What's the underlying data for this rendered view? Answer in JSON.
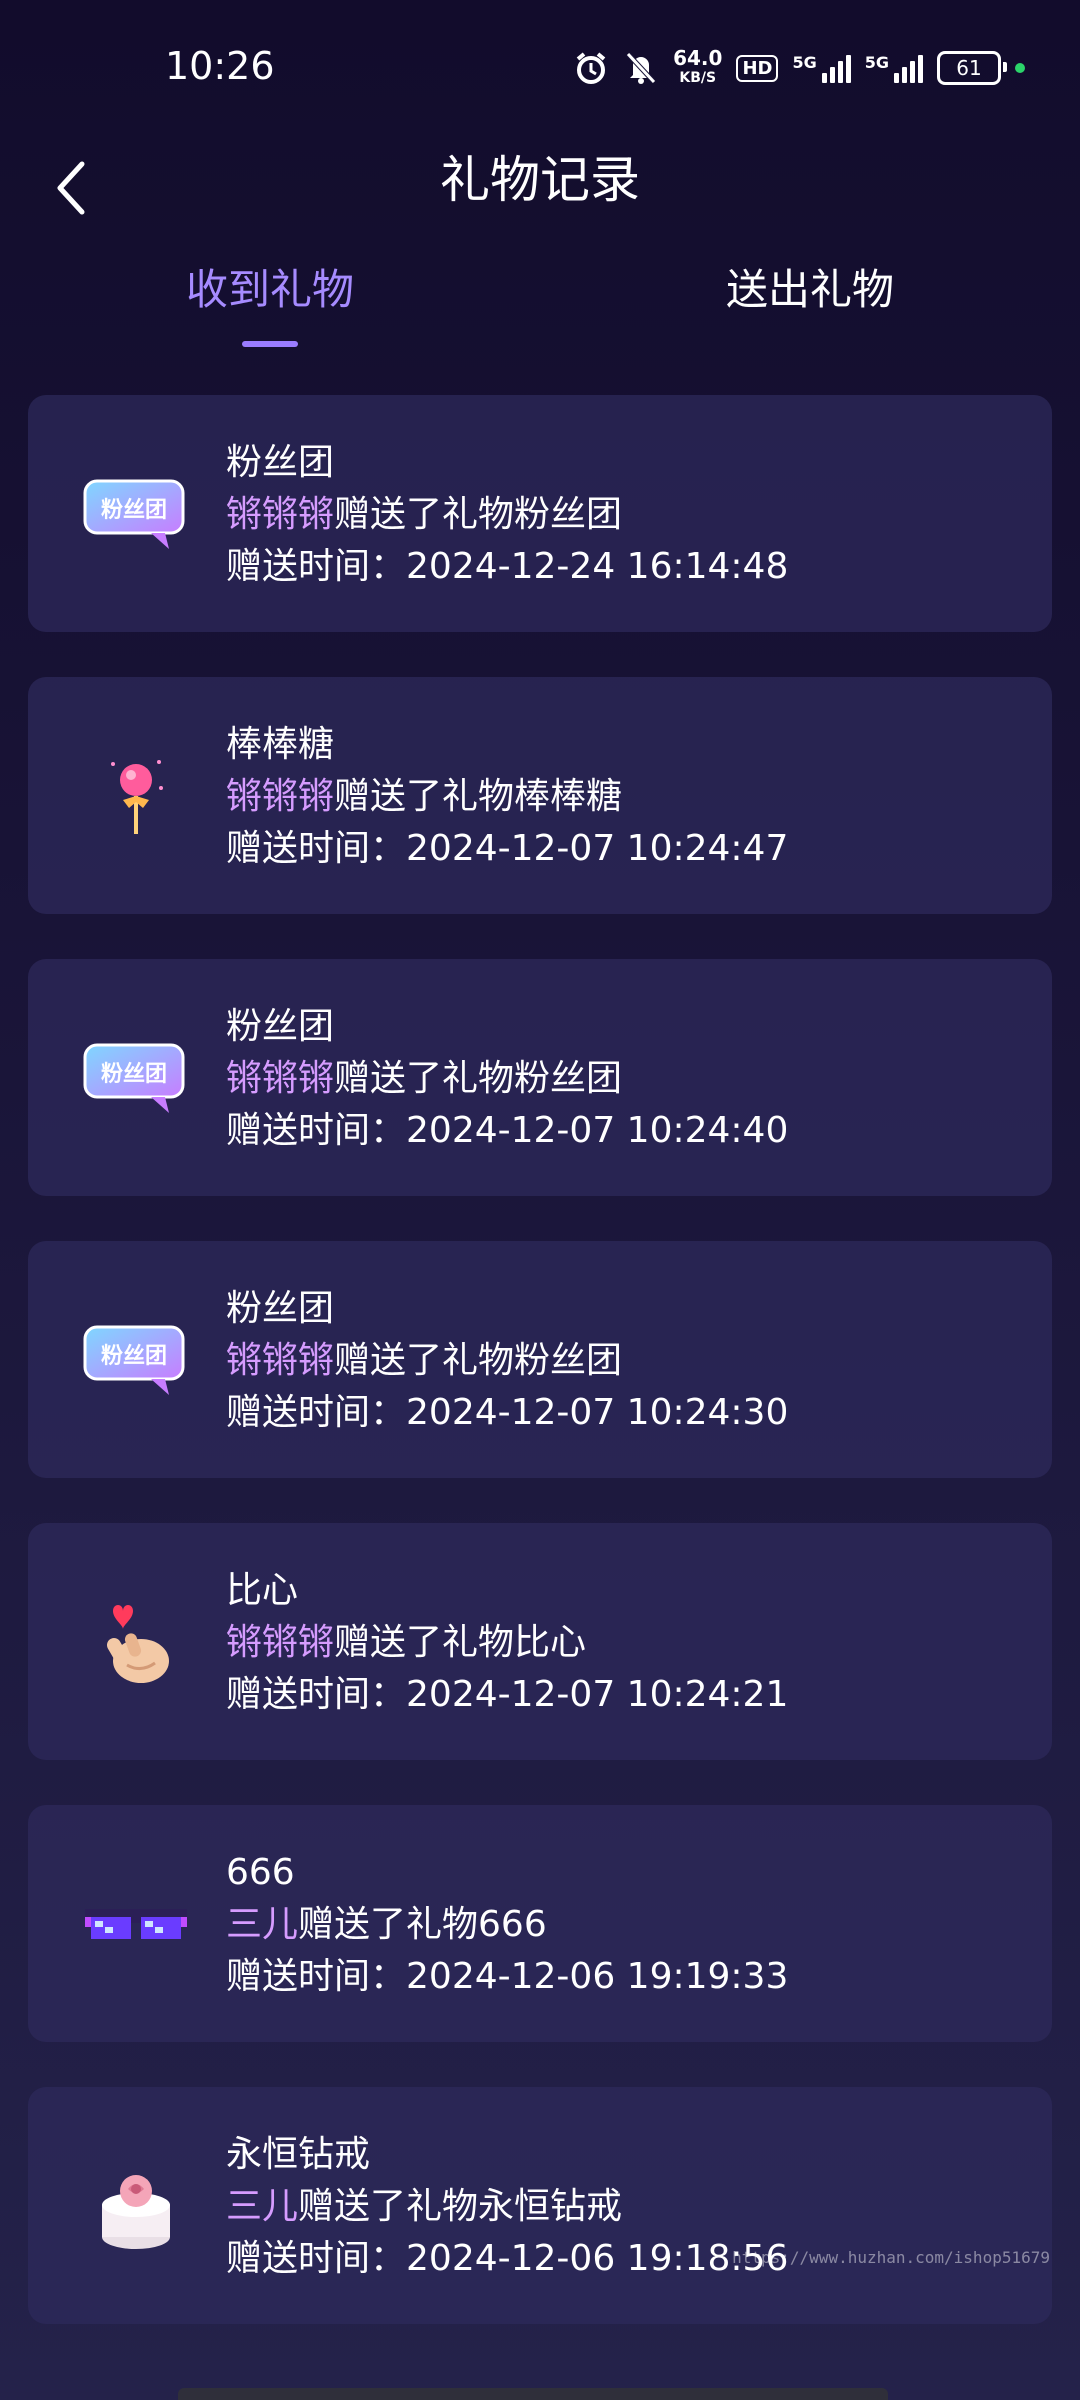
{
  "status_bar": {
    "time": "10:26",
    "net_speed_value": "64.0",
    "net_speed_unit": "KB/S",
    "hd_label": "HD",
    "signal1_label": "5G",
    "signal2_label": "5G",
    "battery": "61"
  },
  "header": {
    "title": "礼物记录"
  },
  "tabs": [
    {
      "label": "收到礼物",
      "active": true
    },
    {
      "label": "送出礼物",
      "active": false
    }
  ],
  "records": [
    {
      "gift_name": "粉丝团",
      "sender": "锵锵锵",
      "action_text": "赠送了礼物粉丝团",
      "time_label": "赠送时间：",
      "time": "2024-12-24 16:14:48",
      "icon": "fan-club-badge-icon"
    },
    {
      "gift_name": "棒棒糖",
      "sender": "锵锵锵",
      "action_text": "赠送了礼物棒棒糖",
      "time_label": "赠送时间：",
      "time": "2024-12-07 10:24:47",
      "icon": "lollipop-icon"
    },
    {
      "gift_name": "粉丝团",
      "sender": "锵锵锵",
      "action_text": "赠送了礼物粉丝团",
      "time_label": "赠送时间：",
      "time": "2024-12-07 10:24:40",
      "icon": "fan-club-badge-icon"
    },
    {
      "gift_name": "粉丝团",
      "sender": "锵锵锵",
      "action_text": "赠送了礼物粉丝团",
      "time_label": "赠送时间：",
      "time": "2024-12-07 10:24:30",
      "icon": "fan-club-badge-icon"
    },
    {
      "gift_name": "比心",
      "sender": "锵锵锵",
      "action_text": "赠送了礼物比心",
      "time_label": "赠送时间：",
      "time": "2024-12-07 10:24:21",
      "icon": "finger-heart-icon"
    },
    {
      "gift_name": "666",
      "sender": "三儿",
      "action_text": "赠送了礼物666",
      "time_label": "赠送时间：",
      "time": "2024-12-06 19:19:33",
      "icon": "pixel-sunglasses-icon"
    },
    {
      "gift_name": "永恒钻戒",
      "sender": "三儿",
      "action_text": "赠送了礼物永恒钻戒",
      "time_label": "赠送时间：",
      "time": "2024-12-06 19:18:56",
      "icon": "ring-box-icon"
    }
  ],
  "fan_badge_text": "粉丝团",
  "watermark": "https://www.huzhan.com/ishop51679",
  "colors": {
    "accent": "#a68bff",
    "sender": "#d69cff",
    "card": "#2e295c"
  }
}
